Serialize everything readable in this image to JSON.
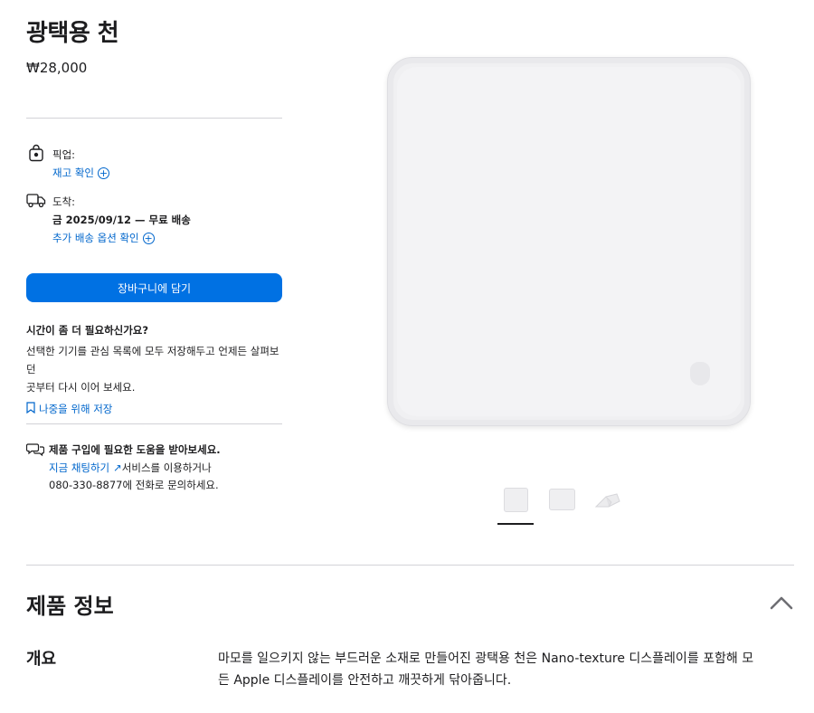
{
  "product": {
    "title": "광택용 천",
    "price": "₩28,000"
  },
  "pickup": {
    "label": "픽업:",
    "link": "재고 확인"
  },
  "delivery": {
    "label": "도착:",
    "date_text": "금 2025/09/12 — 무료 배송",
    "link": "추가 배송 옵션 확인"
  },
  "add_to_bag": "장바구니에 담기",
  "save_later": {
    "heading": "시간이 좀 더 필요하신가요?",
    "line1": "선택한 기기를 관심 목록에 모두 저장해두고 언제든 살펴보던",
    "line2": "곳부터 다시 이어 보세요.",
    "link": "나중을 위해 저장"
  },
  "help": {
    "heading": "제품 구입에 필요한 도움을 받아보세요.",
    "chat_link": "지금 채팅하기",
    "after_chat": "서비스를 이용하거나",
    "phone_line": "080-330-8877에 전화로 문의하세요."
  },
  "gallery": {
    "thumbnails": [
      "thumb-front",
      "thumb-flat",
      "thumb-folded"
    ],
    "selected_index": 0
  },
  "product_info": {
    "section_title": "제품 정보",
    "overview_label": "개요",
    "overview_text": "마모를 일으키지 않는 부드러운 소재로 만들어진 광택용 천은 Nano-texture 디스플레이를 포함해 모든 Apple 디스플레이를 안전하고 깨끗하게 닦아줍니다."
  },
  "colors": {
    "accent": "#0071e3",
    "link": "#0066cc",
    "text": "#1d1d1f",
    "divider": "#d2d2d7"
  }
}
